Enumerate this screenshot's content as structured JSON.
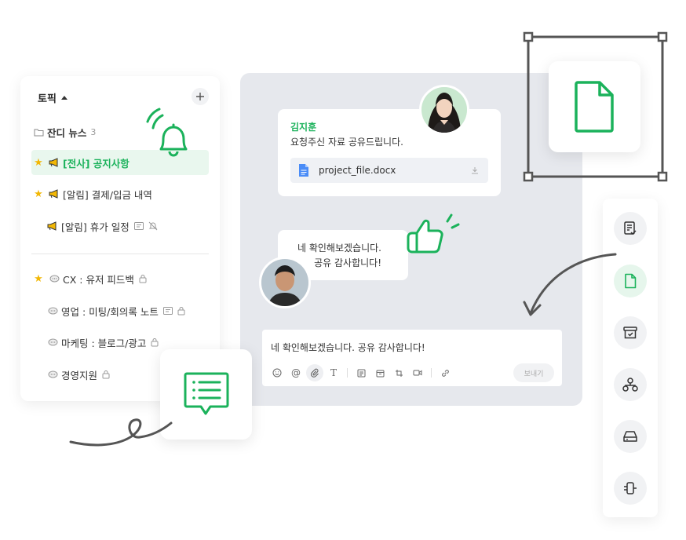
{
  "topics": {
    "header": "토픽",
    "folder": {
      "label": "잔디 뉴스",
      "count": "3"
    },
    "items": [
      {
        "label": "[전사] 공지사항"
      },
      {
        "label": "[알림] 결제/입금 내역"
      },
      {
        "label": "[알림] 휴가 일정"
      },
      {
        "label": "CX : 유저 피드백"
      },
      {
        "label": "영업 : 미팅/회의록 노트"
      },
      {
        "label": "마케팅 : 블로그/광고"
      },
      {
        "label": "경영지원"
      }
    ]
  },
  "chat": {
    "message1": {
      "sender": "김지훈",
      "text": "요청주신 자료 공유드립니다.",
      "file": "project_file.docx"
    },
    "message2": {
      "line1": "네 확인해보겠습니다.",
      "line2": "공유 감사합니다!"
    },
    "composer": {
      "text": "네 확인해보겠습니다. 공유 감사합니다!",
      "send_label": "보내기"
    }
  },
  "dock": {
    "icons": [
      "checklist-icon",
      "file-icon",
      "archive-check-icon",
      "org-chart-icon",
      "drive-icon",
      "integration-icon"
    ],
    "active": "file-icon"
  },
  "colors": {
    "accent": "#1bb25b",
    "chat_bg": "#e6e8ed",
    "star": "#f2b705"
  }
}
